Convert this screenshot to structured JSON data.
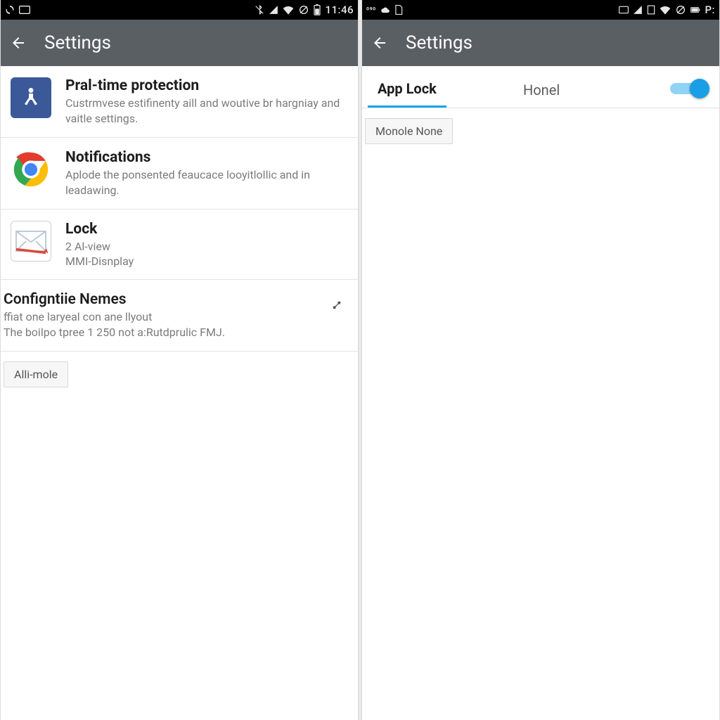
{
  "left": {
    "statusbar": {
      "clock": "11:46",
      "left_icons": [
        "sync-icon",
        "card-icon"
      ],
      "right_icons": [
        "bluetooth-off-icon",
        "signal-icon",
        "wifi-icon",
        "no-data-icon",
        "battery-icon"
      ]
    },
    "appbar": {
      "title": "Settings"
    },
    "rows": [
      {
        "icon": "accessibility-icon",
        "title": "Pral-time protection",
        "sub": "Custrmvese estifinenty aill and woutive br hargniay and vaitle settings."
      },
      {
        "icon": "chrome-icon",
        "title": "Notifications",
        "sub": "Aplode the ponsented feaucace looyitlollic and in leadawing."
      },
      {
        "icon": "mail-icon",
        "title": "Lock",
        "sub": "2 Al-view",
        "sub2": "MMI-Disnplay"
      }
    ],
    "config": {
      "title": "Configntiie Nemes",
      "line1": "ffiat one laryeal con ane llyout",
      "line2": "The boilpo tpree 1 250 not a:Rutdprulic FMJ.",
      "glyph": "↗"
    },
    "chip": "Alli-mole"
  },
  "right": {
    "statusbar": {
      "clock": "P:",
      "left_icons": [
        "num-icon",
        "cloud-icon",
        "page-icon"
      ],
      "right_icons": [
        "card-icon",
        "signal-icon",
        "blank-icon",
        "wifi-icon",
        "no-data-icon",
        "battery-icon"
      ]
    },
    "appbar": {
      "title": "Settings"
    },
    "tabs": [
      {
        "label": "App Lock",
        "active": true
      },
      {
        "label": "Honel",
        "active": false
      }
    ],
    "toggle_on": true,
    "chip": "Monole None"
  }
}
